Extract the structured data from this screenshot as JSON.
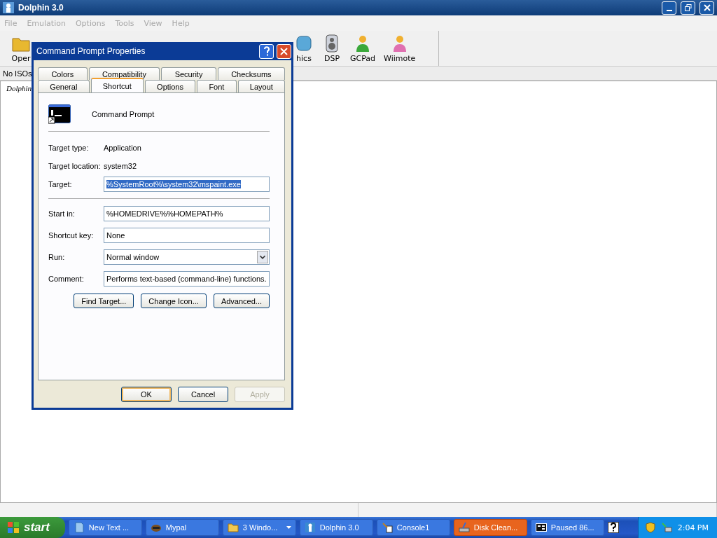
{
  "window": {
    "title": "Dolphin 3.0"
  },
  "menu": [
    "File",
    "Emulation",
    "Options",
    "Tools",
    "View",
    "Help"
  ],
  "toolbar": {
    "left": [
      {
        "label": "Oper",
        "kind": "folder"
      }
    ],
    "right": [
      {
        "label": "hics",
        "kind": "graphics"
      },
      {
        "label": "DSP",
        "kind": "speaker"
      },
      {
        "label": "GCPad",
        "kind": "person-green"
      },
      {
        "label": "Wiimote",
        "kind": "person-pink"
      }
    ]
  },
  "list": {
    "column_1": "No ISOs",
    "row_1": "Dolphin"
  },
  "dialog": {
    "title": "Command Prompt Properties",
    "tab_rows": [
      [
        {
          "label": "Colors",
          "selected": false
        },
        {
          "label": "Compatibility",
          "selected": false
        },
        {
          "label": "Security",
          "selected": false
        },
        {
          "label": "Checksums",
          "selected": false
        }
      ],
      [
        {
          "label": "General",
          "selected": false
        },
        {
          "label": "Shortcut",
          "selected": true
        },
        {
          "label": "Options",
          "selected": false
        },
        {
          "label": "Font",
          "selected": false
        },
        {
          "label": "Layout",
          "selected": false
        }
      ]
    ],
    "name": "Command Prompt",
    "info": [
      {
        "label": "Target type:",
        "value": "Application"
      },
      {
        "label": "Target location:",
        "value": "system32"
      }
    ],
    "target": {
      "label": "Target:",
      "value": "%SystemRoot%\\system32\\mspaint.exe",
      "selected": true
    },
    "fields": [
      {
        "label": "Start in:",
        "value": "%HOMEDRIVE%%HOMEPATH%",
        "kind": "text"
      },
      {
        "label": "Shortcut key:",
        "value": "None",
        "kind": "text"
      },
      {
        "label": "Run:",
        "value": "Normal window",
        "kind": "dropdown"
      },
      {
        "label": "Comment:",
        "value": "Performs text-based (command-line) functions.",
        "kind": "text"
      }
    ],
    "actions": [
      "Find Target...",
      "Change Icon...",
      "Advanced..."
    ],
    "buttons": [
      {
        "label": "OK",
        "default": true,
        "disabled": false
      },
      {
        "label": "Cancel",
        "default": false,
        "disabled": false
      },
      {
        "label": "Apply",
        "default": false,
        "disabled": true
      }
    ]
  },
  "taskbar": {
    "start": "start",
    "items": [
      {
        "label": "New Text ...",
        "kind": "notepad",
        "selected": false
      },
      {
        "label": "Mypal",
        "kind": "mypal",
        "selected": false
      },
      {
        "label": "3 Windo...",
        "kind": "folder",
        "selected": false,
        "group": true
      },
      {
        "label": "Dolphin 3.0",
        "kind": "dolphin",
        "selected": false
      },
      {
        "label": "Console1",
        "kind": "tools",
        "selected": false
      },
      {
        "label": "Disk Clean...",
        "kind": "disk",
        "selected": true
      },
      {
        "label": "Paused 86...",
        "kind": "sevenzip",
        "selected": false
      }
    ],
    "clock": "2:04 PM"
  }
}
